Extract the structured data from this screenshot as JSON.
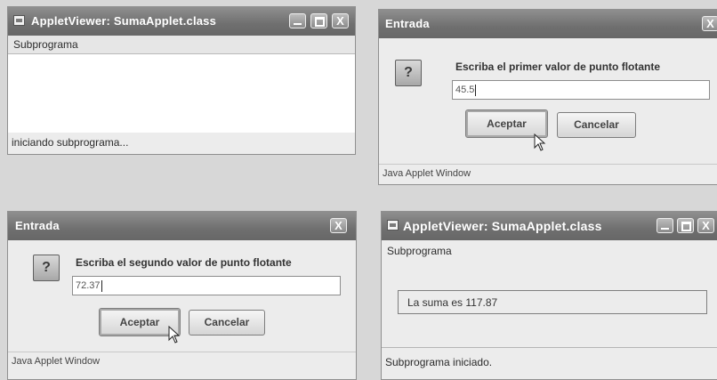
{
  "windows": {
    "applet_start": {
      "title": "AppletViewer: SumaApplet.class",
      "menu": "Subprograma",
      "status": "iniciando subprograma..."
    },
    "input_first": {
      "title": "Entrada",
      "prompt": "Escriba el primer valor de punto flotante",
      "value": "45.5",
      "accept_label": "Aceptar",
      "cancel_label": "Cancelar",
      "footer": "Java Applet Window"
    },
    "input_second": {
      "title": "Entrada",
      "prompt": "Escriba el segundo valor de punto flotante",
      "value": "72.37",
      "accept_label": "Aceptar",
      "cancel_label": "Cancelar",
      "footer": "Java Applet Window"
    },
    "applet_done": {
      "title": "AppletViewer: SumaApplet.class",
      "menu": "Subprograma",
      "result": "La suma es 117.87",
      "status": "Subprograma iniciado."
    }
  },
  "icons": {
    "question": "?",
    "close": "X"
  }
}
